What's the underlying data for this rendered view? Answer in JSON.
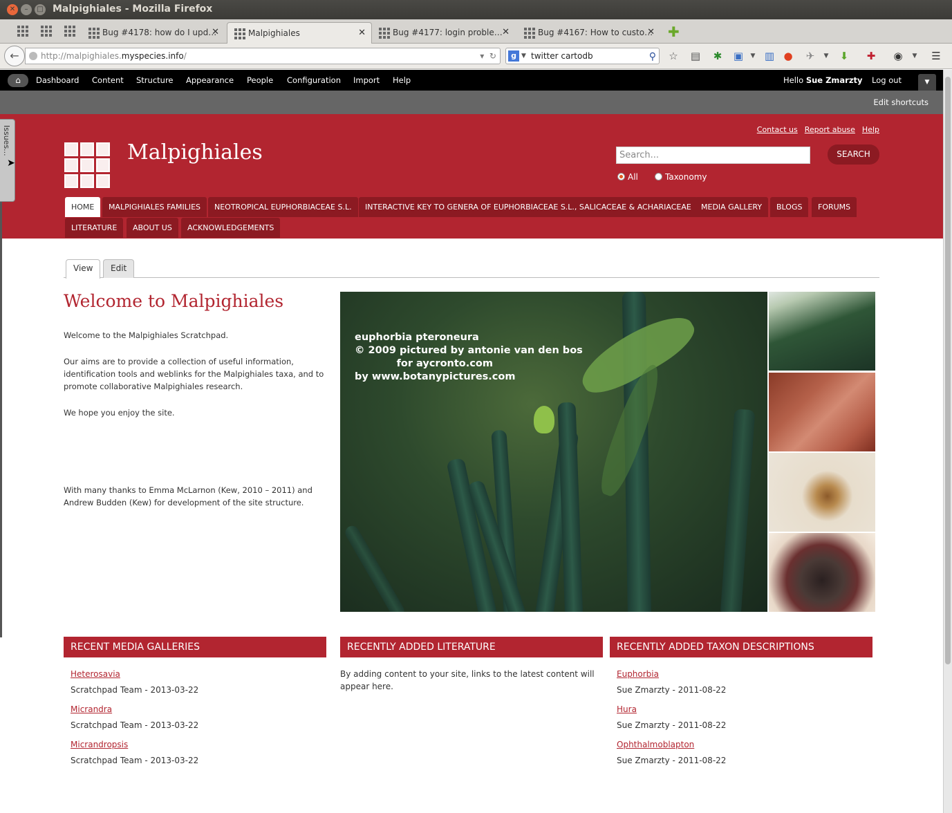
{
  "window": {
    "title": "Malpighiales - Mozilla Firefox"
  },
  "tabs": [
    {
      "label": "Bug #4178: how do I upd…",
      "active": false
    },
    {
      "label": "Malpighiales",
      "active": true
    },
    {
      "label": "Bug #4177: login proble…",
      "active": false
    },
    {
      "label": "Bug #4167: How to custo…",
      "active": false
    }
  ],
  "nav": {
    "url_prefix": "http://malpighiales.",
    "url_domain": "myspecies.info",
    "url_suffix": "/",
    "search_value": "twitter cartodb"
  },
  "admin": {
    "menu": [
      "Dashboard",
      "Content",
      "Structure",
      "Appearance",
      "People",
      "Configuration",
      "Import",
      "Help"
    ],
    "hello_prefix": "Hello ",
    "user": "Sue Zmarzty",
    "logout": "Log out",
    "edit_shortcuts": "Edit shortcuts"
  },
  "issues_tab": "Issues...",
  "site": {
    "name": "Malpighiales",
    "top_links": [
      "Contact us",
      "Report abuse",
      "Help"
    ],
    "search_placeholder": "Search...",
    "search_button": "SEARCH",
    "search_scope": [
      {
        "label": "All",
        "checked": true
      },
      {
        "label": "Taxonomy",
        "checked": false
      }
    ],
    "primary_tabs": [
      "HOME",
      "MALPIGHIALES FAMILIES",
      "NEOTROPICAL EUPHORBIACEAE S.L.",
      "INTERACTIVE KEY TO GENERA OF EUPHORBIACEAE S.L., SALICACEAE & ACHARIACEAE",
      "MEDIA GALLERY",
      "BLOGS",
      "FORUMS",
      "LITERATURE",
      "ABOUT US",
      "ACKNOWLEDGEMENTS"
    ]
  },
  "content": {
    "view_tabs": [
      "View",
      "Edit"
    ],
    "title": "Welcome to Malpighiales",
    "paragraphs": [
      "Welcome to the Malpighiales Scratchpad.",
      "Our aims are to provide a collection of useful information, identification tools and weblinks for the Malpighiales taxa, and to promote collaborative Malpighiales research.",
      "We hope you enjoy the site.",
      "With many thanks to Emma McLarnon (Kew, 2010 – 2011) and Andrew Budden (Kew) for development of the site structure."
    ],
    "image_caption": "euphorbia pteroneura\n© 2009 pictured by antonie van den bos\n            for aycronto.com\nby www.botanypictures.com"
  },
  "blocks": {
    "media": {
      "title": "RECENT MEDIA GALLERIES",
      "items": [
        {
          "link": "Heterosavia",
          "meta": "Scratchpad Team - 2013-03-22"
        },
        {
          "link": "Micrandra",
          "meta": "Scratchpad Team - 2013-03-22"
        },
        {
          "link": "Micrandropsis",
          "meta": "Scratchpad Team - 2013-03-22"
        }
      ]
    },
    "literature": {
      "title": "RECENTLY ADDED LITERATURE",
      "empty_text": "By adding content to your site, links to the latest content will appear here."
    },
    "taxon": {
      "title": "RECENTLY ADDED TAXON DESCRIPTIONS",
      "items": [
        {
          "link": "Euphorbia",
          "meta": "Sue Zmarzty - 2011-08-22"
        },
        {
          "link": "Hura",
          "meta": "Sue Zmarzty - 2011-08-22"
        },
        {
          "link": "Ophthalmoblapton",
          "meta": "Sue Zmarzty - 2011-08-22"
        }
      ]
    }
  },
  "colors": {
    "brand": "#b22530",
    "brand_dark": "#8c1a22"
  }
}
